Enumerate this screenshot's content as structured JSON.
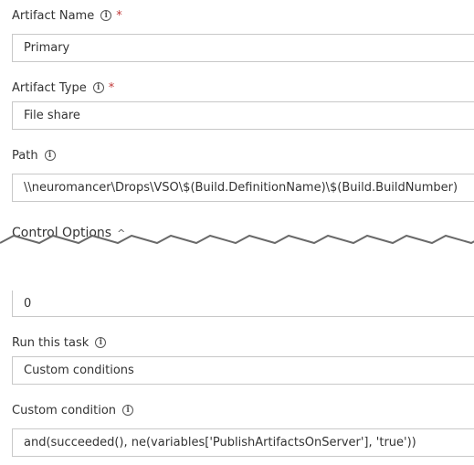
{
  "fields": {
    "artifact_name": {
      "label": "Artifact Name",
      "required_mark": "*",
      "value": "Primary"
    },
    "artifact_type": {
      "label": "Artifact Type",
      "required_mark": "*",
      "value": "File share"
    },
    "path": {
      "label": "Path",
      "value": "\\\\neuromancer\\Drops\\VSO\\$(Build.DefinitionName)\\$(Build.BuildNumber)"
    },
    "timeout_fragment": {
      "value": "0"
    },
    "run_this_task": {
      "label": "Run this task",
      "value": "Custom conditions"
    },
    "custom_condition": {
      "label": "Custom condition",
      "value": "and(succeeded(), ne(variables['PublishArtifactsOnServer'], 'true'))"
    }
  },
  "section": {
    "title": "Control Options"
  },
  "icons": {
    "info": "info-icon",
    "chevron": "chevron-up-icon"
  },
  "colors": {
    "required": "#c13a3a",
    "border": "#c8c8c8"
  }
}
